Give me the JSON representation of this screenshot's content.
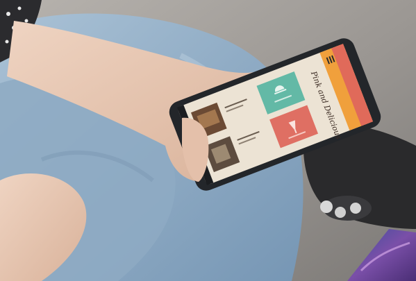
{
  "scene": {
    "description_free": true,
    "colors": {
      "floor": "#8f8c89",
      "jeans": "#9cb6cc",
      "skin": "#e7c7b3",
      "phone_body": "#23262a",
      "screen_bg": "#ece3d4",
      "header_orange": "#f0a03c",
      "header_coral": "#e06a5a",
      "tile_teal": "#63b9a6",
      "tile_coral": "#df6f63",
      "book_purple": "#5a3f8f"
    }
  },
  "phone_screen": {
    "title_script": "Pink and Delicious",
    "menu_icon": "hamburger-icon"
  }
}
